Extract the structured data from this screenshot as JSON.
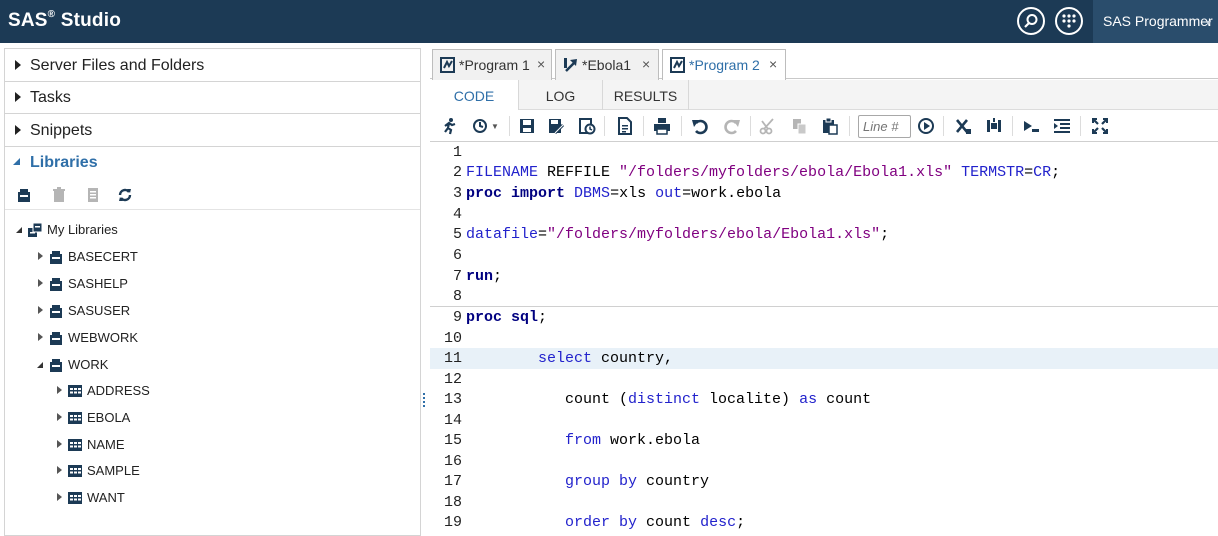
{
  "app": {
    "title": "SAS",
    "title_sup": "®",
    "title_suffix": " Studio",
    "user_menu_label": "SAS Programmer",
    "colors": {
      "topbar": "#1c3a55",
      "accent": "#2f6fa8"
    }
  },
  "sidebar": {
    "sections": [
      {
        "label": "Server Files and Folders"
      },
      {
        "label": "Tasks"
      },
      {
        "label": "Snippets"
      },
      {
        "label": "Libraries"
      }
    ],
    "tree": {
      "root": "My Libraries",
      "libraries": [
        "BASECERT",
        "SASHELP",
        "SASUSER",
        "WEBWORK",
        "WORK"
      ],
      "work_tables": [
        "ADDRESS",
        "EBOLA",
        "NAME",
        "SAMPLE",
        "WANT"
      ]
    }
  },
  "editor": {
    "tabs": [
      {
        "label": "*Program 1",
        "icon": "program-icon"
      },
      {
        "label": "*Ebola1",
        "icon": "import-icon"
      },
      {
        "label": "*Program 2",
        "icon": "program-icon"
      }
    ],
    "close_glyph": "×",
    "subtabs": [
      "CODE",
      "LOG",
      "RESULTS"
    ],
    "line_placeholder": "Line #",
    "line_numbers": [
      "1",
      "2",
      "3",
      "4",
      "5",
      "6",
      "7",
      "8",
      "9",
      "10",
      "11",
      "12",
      "13",
      "14",
      "15",
      "16",
      "17",
      "18",
      "19"
    ],
    "code": {
      "l2": [
        "FILENAME",
        " REFFILE ",
        "\"/folders/myfolders/ebola/Ebola1.xls\"",
        " ",
        "TERMSTR",
        "=",
        "CR",
        ";"
      ],
      "l3": [
        "proc import",
        " ",
        "DBMS",
        "=xls ",
        "out",
        "=work.ebola"
      ],
      "l5": [
        "datafile",
        "=",
        "\"/folders/myfolders/ebola/Ebola1.xls\"",
        ";"
      ],
      "l7": [
        "run",
        ";"
      ],
      "l9": [
        "proc sql",
        ";"
      ],
      "l11": [
        "        ",
        "select",
        " country,"
      ],
      "l13": [
        "           count (",
        "distinct",
        " localite) ",
        "as",
        " count"
      ],
      "l15": [
        "           ",
        "from",
        " work.ebola"
      ],
      "l17": [
        "           ",
        "group by",
        " country"
      ],
      "l19": [
        "           ",
        "order by",
        " count ",
        "desc",
        ";"
      ]
    }
  }
}
